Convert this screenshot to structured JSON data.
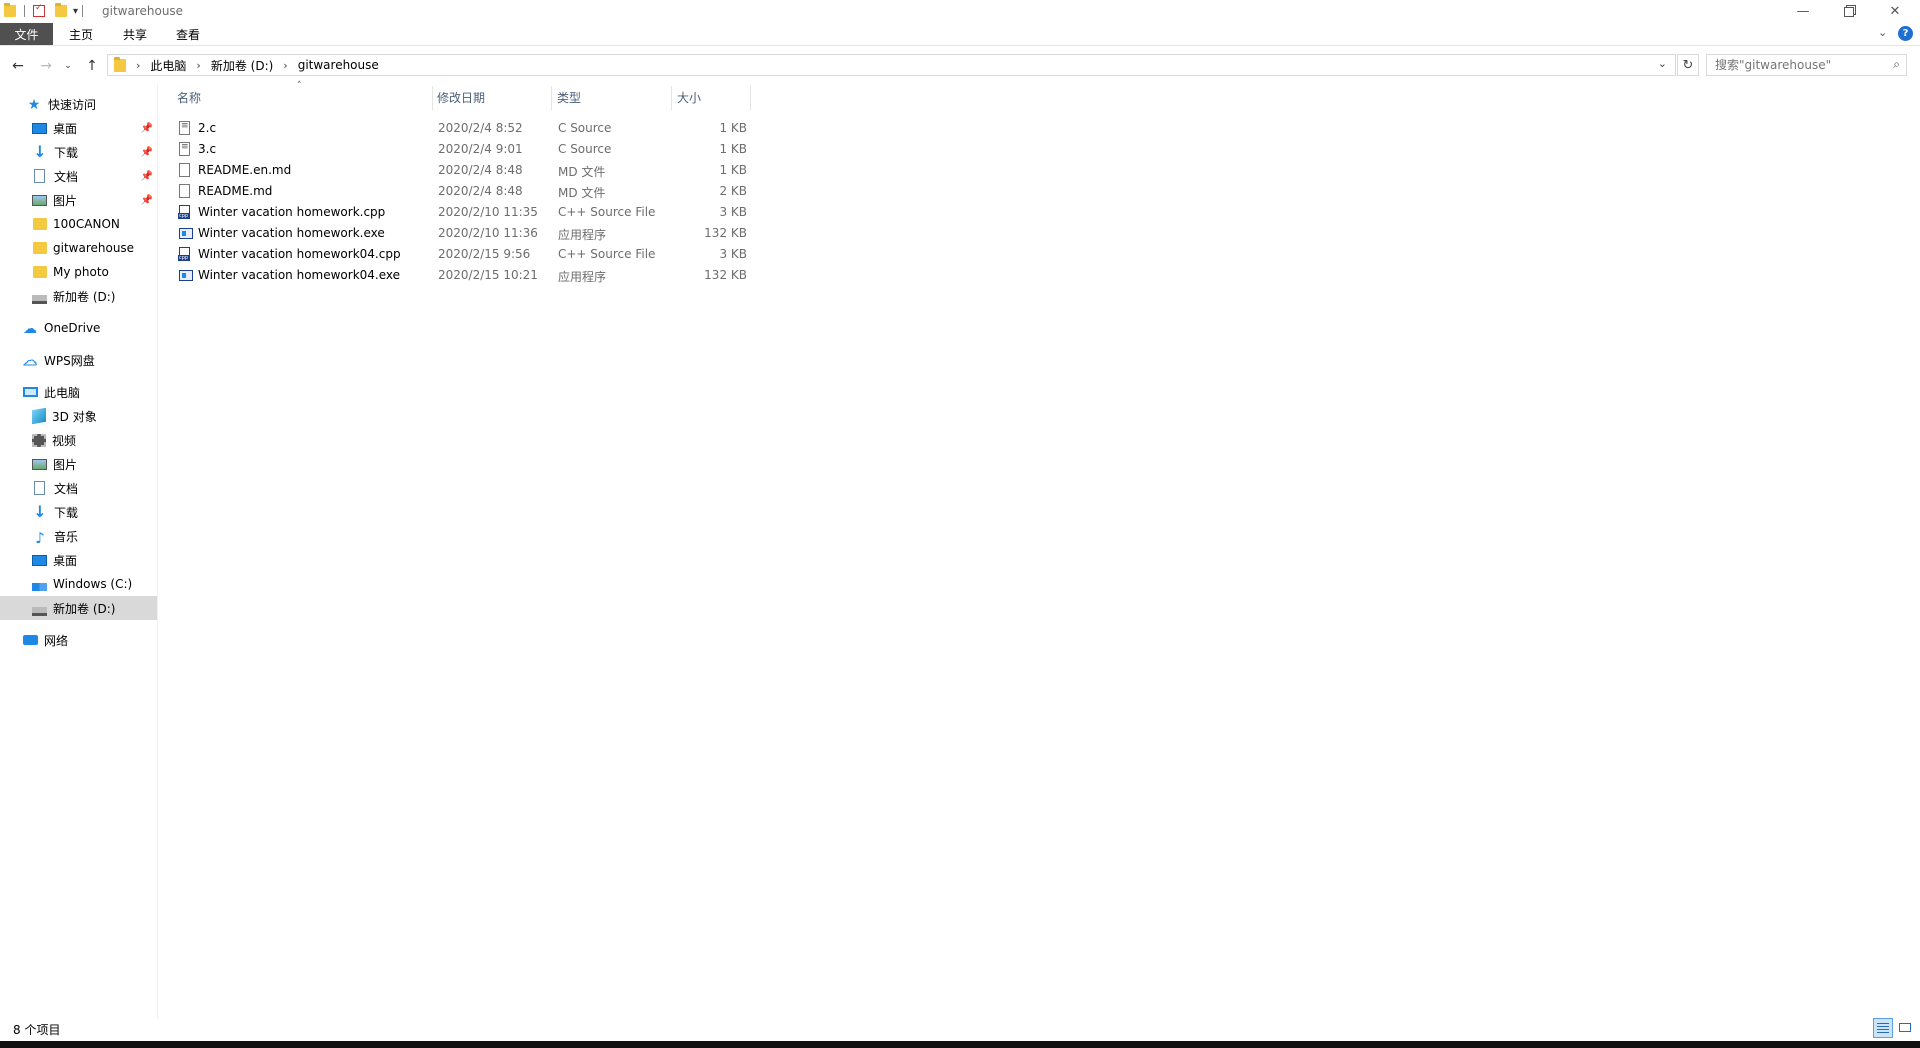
{
  "window": {
    "title": "gitwarehouse",
    "quick_access_dropdown": "▾"
  },
  "ribbon": {
    "tabs": [
      {
        "label": "文件"
      },
      {
        "label": "主页"
      },
      {
        "label": "共享"
      },
      {
        "label": "查看"
      }
    ]
  },
  "address": {
    "crumbs": [
      "此电脑",
      "新加卷 (D:)",
      "gitwarehouse"
    ]
  },
  "search": {
    "placeholder": "搜索\"gitwarehouse\""
  },
  "sidebar": {
    "items": [
      {
        "label": "快速访问",
        "icon": "star-icon"
      },
      {
        "label": "桌面",
        "icon": "desktop-icon",
        "pinned": true
      },
      {
        "label": "下载",
        "icon": "download-icon",
        "pinned": true
      },
      {
        "label": "文档",
        "icon": "document-icon",
        "pinned": true
      },
      {
        "label": "图片",
        "icon": "pictures-icon",
        "pinned": true
      },
      {
        "label": "100CANON",
        "icon": "folder-icon"
      },
      {
        "label": "gitwarehouse",
        "icon": "folder-icon"
      },
      {
        "label": "My photo",
        "icon": "folder-icon"
      },
      {
        "label": "新加卷 (D:)",
        "icon": "drive-icon"
      },
      {
        "label": "OneDrive",
        "icon": "cloud-icon"
      },
      {
        "label": "WPS网盘",
        "icon": "cloud-icon"
      },
      {
        "label": "此电脑",
        "icon": "computer-icon"
      },
      {
        "label": "3D 对象",
        "icon": "3d-objects-icon"
      },
      {
        "label": "视频",
        "icon": "video-icon"
      },
      {
        "label": "图片",
        "icon": "pictures-icon"
      },
      {
        "label": "文档",
        "icon": "document-icon"
      },
      {
        "label": "下载",
        "icon": "download-icon"
      },
      {
        "label": "音乐",
        "icon": "music-icon"
      },
      {
        "label": "桌面",
        "icon": "desktop-icon"
      },
      {
        "label": "Windows (C:)",
        "icon": "windows-drive-icon"
      },
      {
        "label": "新加卷 (D:)",
        "icon": "drive-icon",
        "selected": true
      },
      {
        "label": "网络",
        "icon": "network-icon"
      }
    ]
  },
  "columns": {
    "name": "名称",
    "date": "修改日期",
    "type": "类型",
    "size": "大小"
  },
  "files": [
    {
      "name": "2.c",
      "date": "2020/2/4 8:52",
      "type": "C Source",
      "size": "1 KB",
      "icon": "c-file-icon"
    },
    {
      "name": "3.c",
      "date": "2020/2/4 9:01",
      "type": "C Source",
      "size": "1 KB",
      "icon": "c-file-icon"
    },
    {
      "name": "README.en.md",
      "date": "2020/2/4 8:48",
      "type": "MD 文件",
      "size": "1 KB",
      "icon": "file-icon"
    },
    {
      "name": "README.md",
      "date": "2020/2/4 8:48",
      "type": "MD 文件",
      "size": "2 KB",
      "icon": "file-icon"
    },
    {
      "name": "Winter vacation homework.cpp",
      "date": "2020/2/10 11:35",
      "type": "C++ Source File",
      "size": "3 KB",
      "icon": "cpp-file-icon"
    },
    {
      "name": "Winter vacation homework.exe",
      "date": "2020/2/10 11:36",
      "type": "应用程序",
      "size": "132 KB",
      "icon": "exe-file-icon"
    },
    {
      "name": "Winter vacation homework04.cpp",
      "date": "2020/2/15 9:56",
      "type": "C++ Source File",
      "size": "3 KB",
      "icon": "cpp-file-icon"
    },
    {
      "name": "Winter vacation homework04.exe",
      "date": "2020/2/15 10:21",
      "type": "应用程序",
      "size": "132 KB",
      "icon": "exe-file-icon"
    }
  ],
  "status": {
    "item_count": "8 个项目"
  }
}
